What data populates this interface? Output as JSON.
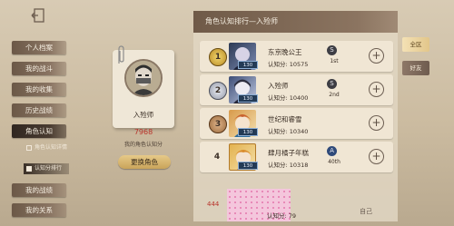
{
  "menu": {
    "items": [
      "个人档案",
      "我的战斗",
      "我的收集",
      "历史战绩",
      "角色认知",
      "我的战绩",
      "我的关系"
    ],
    "sub_items": [
      "角色认知详情",
      "认知分排行"
    ]
  },
  "card": {
    "name": "入殓师",
    "score": "7968",
    "score_label": "我的角色认知分",
    "change_button": "更换角色"
  },
  "panel": {
    "title": "角色认知排行—入殓师",
    "rows": [
      {
        "rank": "1",
        "name": "东京晚公王",
        "level": "130",
        "score": "认知分: 10575",
        "tier": "1st"
      },
      {
        "rank": "2",
        "name": "入殓师",
        "level": "130",
        "score": "认知分: 10400",
        "tier": "2nd"
      },
      {
        "rank": "3",
        "name": "世纪和睿雪",
        "level": "130",
        "score": "认知分: 10340",
        "tier": ""
      },
      {
        "rank": "4",
        "name": "肆月橘子年糕",
        "level": "130",
        "score": "认知分: 10318",
        "tier": "40th"
      }
    ],
    "self": {
      "rank": "444",
      "score": "认知分: 79",
      "label": "自己"
    }
  },
  "tabs": {
    "all": "全区",
    "friends": "好友"
  },
  "colors": {
    "accent": "#c9a45a",
    "panel_header": "#6f5a48",
    "score_red": "#b8322a"
  }
}
